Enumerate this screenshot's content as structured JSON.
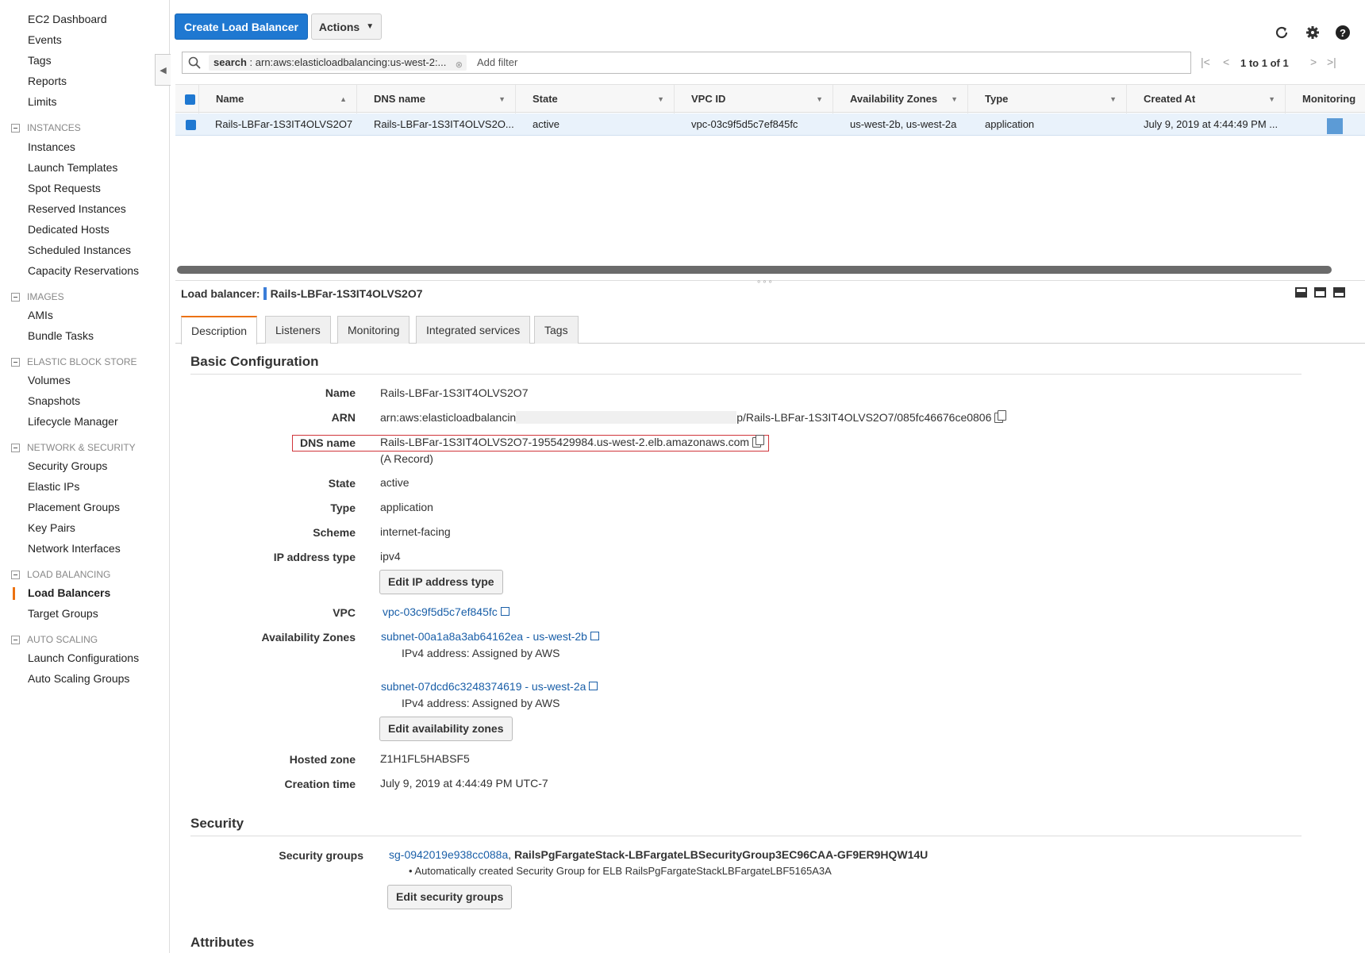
{
  "sidebar": {
    "top_items": [
      "EC2 Dashboard",
      "Events",
      "Tags",
      "Reports",
      "Limits"
    ],
    "sections": [
      {
        "heading": "INSTANCES",
        "items": [
          "Instances",
          "Launch Templates",
          "Spot Requests",
          "Reserved Instances",
          "Dedicated Hosts",
          "Scheduled Instances",
          "Capacity Reservations"
        ]
      },
      {
        "heading": "IMAGES",
        "items": [
          "AMIs",
          "Bundle Tasks"
        ]
      },
      {
        "heading": "ELASTIC BLOCK STORE",
        "items": [
          "Volumes",
          "Snapshots",
          "Lifecycle Manager"
        ]
      },
      {
        "heading": "NETWORK & SECURITY",
        "items": [
          "Security Groups",
          "Elastic IPs",
          "Placement Groups",
          "Key Pairs",
          "Network Interfaces"
        ]
      },
      {
        "heading": "LOAD BALANCING",
        "items": [
          "Load Balancers",
          "Target Groups"
        ]
      },
      {
        "heading": "AUTO SCALING",
        "items": [
          "Launch Configurations",
          "Auto Scaling Groups"
        ]
      }
    ],
    "active_item": "Load Balancers"
  },
  "toolbar": {
    "create_label": "Create Load Balancer",
    "actions_label": "Actions",
    "icons": [
      "refresh-icon",
      "gear-icon",
      "help-icon"
    ]
  },
  "search": {
    "token_key": "search",
    "token_value": "arn:aws:elasticloadbalancing:us-west-2:...",
    "add_filter": "Add filter",
    "pager_text": "1 to 1 of 1"
  },
  "table": {
    "columns": [
      "Name",
      "DNS name",
      "State",
      "VPC ID",
      "Availability Zones",
      "Type",
      "Created At",
      "Monitoring"
    ],
    "rows": [
      [
        "Rails-LBFar-1S3IT4OLVS2O7",
        "Rails-LBFar-1S3IT4OLVS2O...",
        "active",
        "vpc-03c9f5d5c7ef845fc",
        "us-west-2b, us-west-2a",
        "application",
        "July 9, 2019 at 4:44:49 PM ...",
        ""
      ]
    ]
  },
  "detail": {
    "title_label": "Load balancer:",
    "title_value": "Rails-LBFar-1S3IT4OLVS2O7",
    "tabs": [
      "Description",
      "Listeners",
      "Monitoring",
      "Integrated services",
      "Tags"
    ],
    "basic_heading": "Basic Configuration",
    "fields": {
      "name": {
        "label": "Name",
        "value": "Rails-LBFar-1S3IT4OLVS2O7"
      },
      "arn": {
        "label": "ARN",
        "value_start": "arn:aws:elasticloadbalancin",
        "value_end": "p/Rails-LBFar-1S3IT4OLVS2O7/085fc46676ce0806"
      },
      "dns": {
        "label": "DNS name",
        "value": "Rails-LBFar-1S3IT4OLVS2O7-1955429984.us-west-2.elb.amazonaws.com",
        "note": "(A Record)"
      },
      "state": {
        "label": "State",
        "value": "active"
      },
      "type": {
        "label": "Type",
        "value": "application"
      },
      "scheme": {
        "label": "Scheme",
        "value": "internet-facing"
      },
      "ip_type": {
        "label": "IP address type",
        "value": "ipv4"
      },
      "vpc": {
        "label": "VPC",
        "value": "vpc-03c9f5d5c7ef845fc"
      },
      "azs": {
        "label": "Availability Zones",
        "subnets": [
          {
            "link": "subnet-00a1a8a3ab64162ea - us-west-2b",
            "ipv4": "IPv4 address: Assigned by AWS"
          },
          {
            "link": "subnet-07dcd6c3248374619 - us-west-2a",
            "ipv4": "IPv4 address: Assigned by AWS"
          }
        ]
      },
      "hosted_zone": {
        "label": "Hosted zone",
        "value": "Z1H1FL5HABSF5"
      },
      "creation_time": {
        "label": "Creation time",
        "value": "July 9, 2019 at 4:44:49 PM UTC-7"
      }
    },
    "buttons": {
      "edit_ip": "Edit IP address type",
      "edit_az": "Edit availability zones",
      "edit_sg": "Edit security groups"
    },
    "security_heading": "Security",
    "security": {
      "label": "Security groups",
      "sg_link": "sg-0942019e938cc088a",
      "sg_name": "RailsPgFargateStack-LBFargateLBSecurityGroup3EC96CAA-GF9ER9HQW14U",
      "sg_desc": "• Automatically created Security Group for ELB RailsPgFargateStackLBFargateLBF5165A3A"
    },
    "attributes_heading": "Attributes"
  },
  "colors": {
    "primary": "#1f78d1",
    "active_accent": "#ec7211",
    "selected_row": "#e9f2fb",
    "highlight_box": "#d0353b",
    "link": "#1a5fa8"
  }
}
